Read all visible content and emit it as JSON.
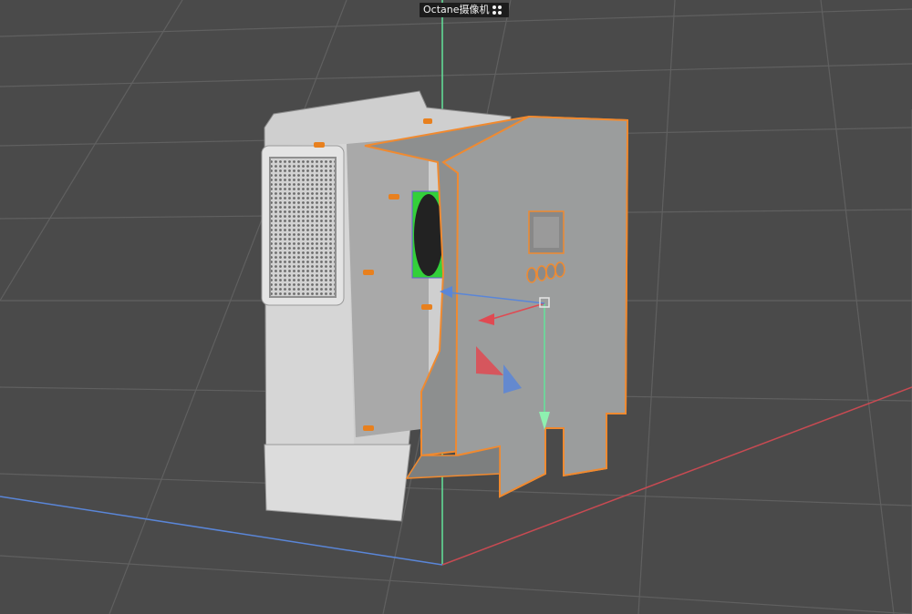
{
  "viewport": {
    "camera_label": "Octane摄像机",
    "camera_icon": "octane-camera-icon",
    "colors": {
      "background": "#4a4a4a",
      "grid": "#606060",
      "axis_x": "#c84a52",
      "axis_y": "#63e39a",
      "axis_z": "#5a86d8",
      "selection": "#f08a30"
    }
  }
}
